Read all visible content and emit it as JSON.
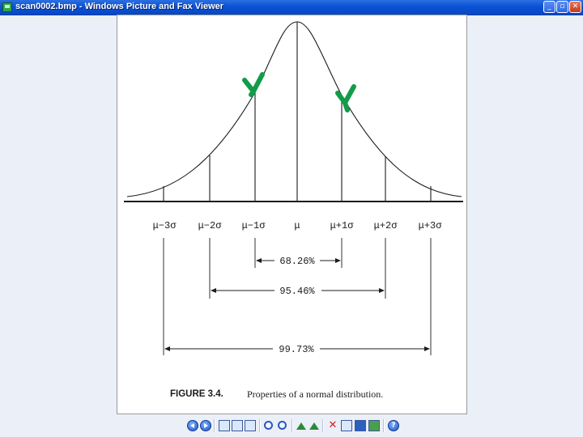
{
  "window": {
    "title": "scan0002.bmp - Windows Picture and Fax Viewer",
    "app_icon": "picture-viewer-icon",
    "controls": {
      "minimize": "_",
      "maximize": "▫",
      "close": "✕"
    }
  },
  "figure": {
    "caption_number": "FIGURE 3.4.",
    "caption_text": "Properties of a normal distribution.",
    "sigma_labels": [
      "μ−3σ",
      "μ−2σ",
      "μ−1σ",
      "μ",
      "μ+1σ",
      "μ+2σ",
      "μ+3σ"
    ],
    "ranges": [
      {
        "label": "68.26%",
        "from": "μ−1σ",
        "to": "μ+1σ"
      },
      {
        "label": "95.46%",
        "from": "μ−2σ",
        "to": "μ+2σ"
      },
      {
        "label": "99.73%",
        "from": "μ−3σ",
        "to": "μ+3σ"
      }
    ],
    "annotation": "green check marks at μ−1σ and μ+1σ",
    "ink_color": "#1c1c1c",
    "marker_color": "#129c4a"
  },
  "toolbar": {
    "buttons": [
      {
        "name": "previous-image-icon",
        "symbol": ""
      },
      {
        "name": "next-image-icon",
        "symbol": ""
      },
      {
        "name": "best-fit-icon",
        "symbol": ""
      },
      {
        "name": "actual-size-icon",
        "symbol": ""
      },
      {
        "name": "slideshow-icon",
        "symbol": ""
      },
      {
        "name": "zoom-in-icon",
        "symbol": ""
      },
      {
        "name": "zoom-out-icon",
        "symbol": ""
      },
      {
        "name": "rotate-clockwise-icon",
        "symbol": ""
      },
      {
        "name": "rotate-counterclockwise-icon",
        "symbol": ""
      },
      {
        "name": "delete-icon",
        "symbol": "✕"
      },
      {
        "name": "print-icon",
        "symbol": ""
      },
      {
        "name": "save-icon",
        "symbol": ""
      },
      {
        "name": "edit-icon",
        "symbol": ""
      },
      {
        "name": "help-icon",
        "symbol": "?"
      }
    ]
  }
}
